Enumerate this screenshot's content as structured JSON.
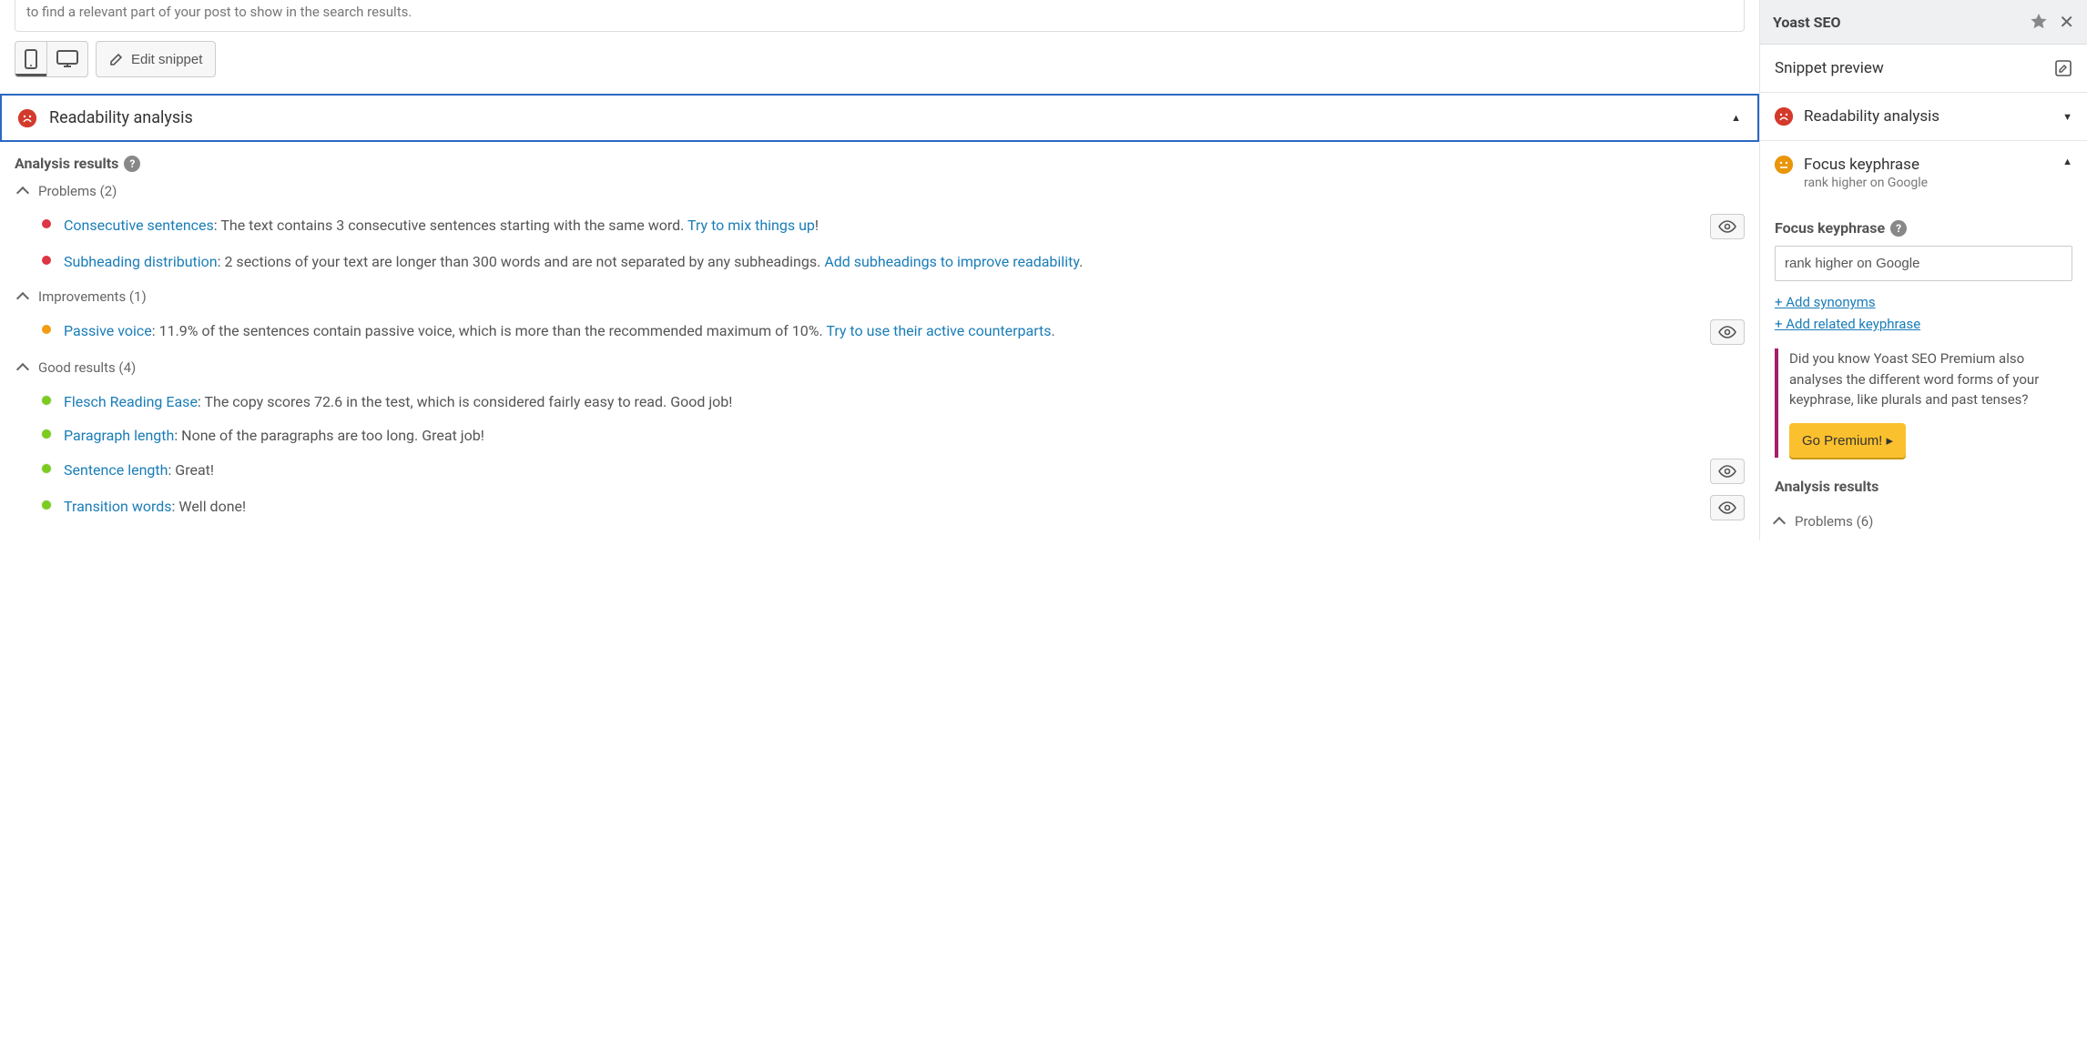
{
  "top_text": "to find a relevant part of your post to show in the search results.",
  "toolbar": {
    "edit_snippet": "Edit snippet"
  },
  "readability": {
    "title": "Readability analysis",
    "results_label": "Analysis results",
    "groups": {
      "problems": {
        "label": "Problems (2)",
        "items": [
          {
            "link": "Consecutive sentences",
            "text": ": The text contains 3 consecutive sentences starting with the same word. ",
            "link2": "Try to mix things up",
            "tail": "!",
            "has_eye": true
          },
          {
            "link": "Subheading distribution",
            "text": ": 2 sections of your text are longer than 300 words and are not separated by any subheadings. ",
            "link2": "Add subheadings to improve readability",
            "tail": ".",
            "has_eye": false
          }
        ]
      },
      "improvements": {
        "label": "Improvements (1)",
        "items": [
          {
            "link": "Passive voice",
            "text": ": 11.9% of the sentences contain passive voice, which is more than the recommended maximum of 10%. ",
            "link2": "Try to use their active counterparts",
            "tail": ".",
            "has_eye": true
          }
        ]
      },
      "good": {
        "label": "Good results (4)",
        "items": [
          {
            "link": "Flesch Reading Ease",
            "text": ": The copy scores 72.6 in the test, which is considered fairly easy to read. Good job!",
            "has_eye": false
          },
          {
            "link": "Paragraph length",
            "text": ": None of the paragraphs are too long. Great job!",
            "has_eye": false
          },
          {
            "link": "Sentence length",
            "text": ": Great!",
            "has_eye": true
          },
          {
            "link": "Transition words",
            "text": ": Well done!",
            "has_eye": true
          }
        ]
      }
    }
  },
  "sidebar": {
    "title": "Yoast SEO",
    "snippet_preview": "Snippet preview",
    "readability": "Readability analysis",
    "focus_keyphrase_label": "Focus keyphrase",
    "focus_keyphrase_sub": "rank higher on Google",
    "keyphrase_label": "Focus keyphrase",
    "keyphrase_value": "rank higher on Google",
    "add_synonyms": "+ Add synonyms",
    "add_related": "+ Add related keyphrase",
    "promo_text": "Did you know Yoast SEO Premium also analyses the different word forms of your keyphrase, like plurals and past tenses?",
    "premium_btn": "Go Premium! ▸",
    "analysis_results": "Analysis results",
    "problems_label": "Problems (6)"
  }
}
